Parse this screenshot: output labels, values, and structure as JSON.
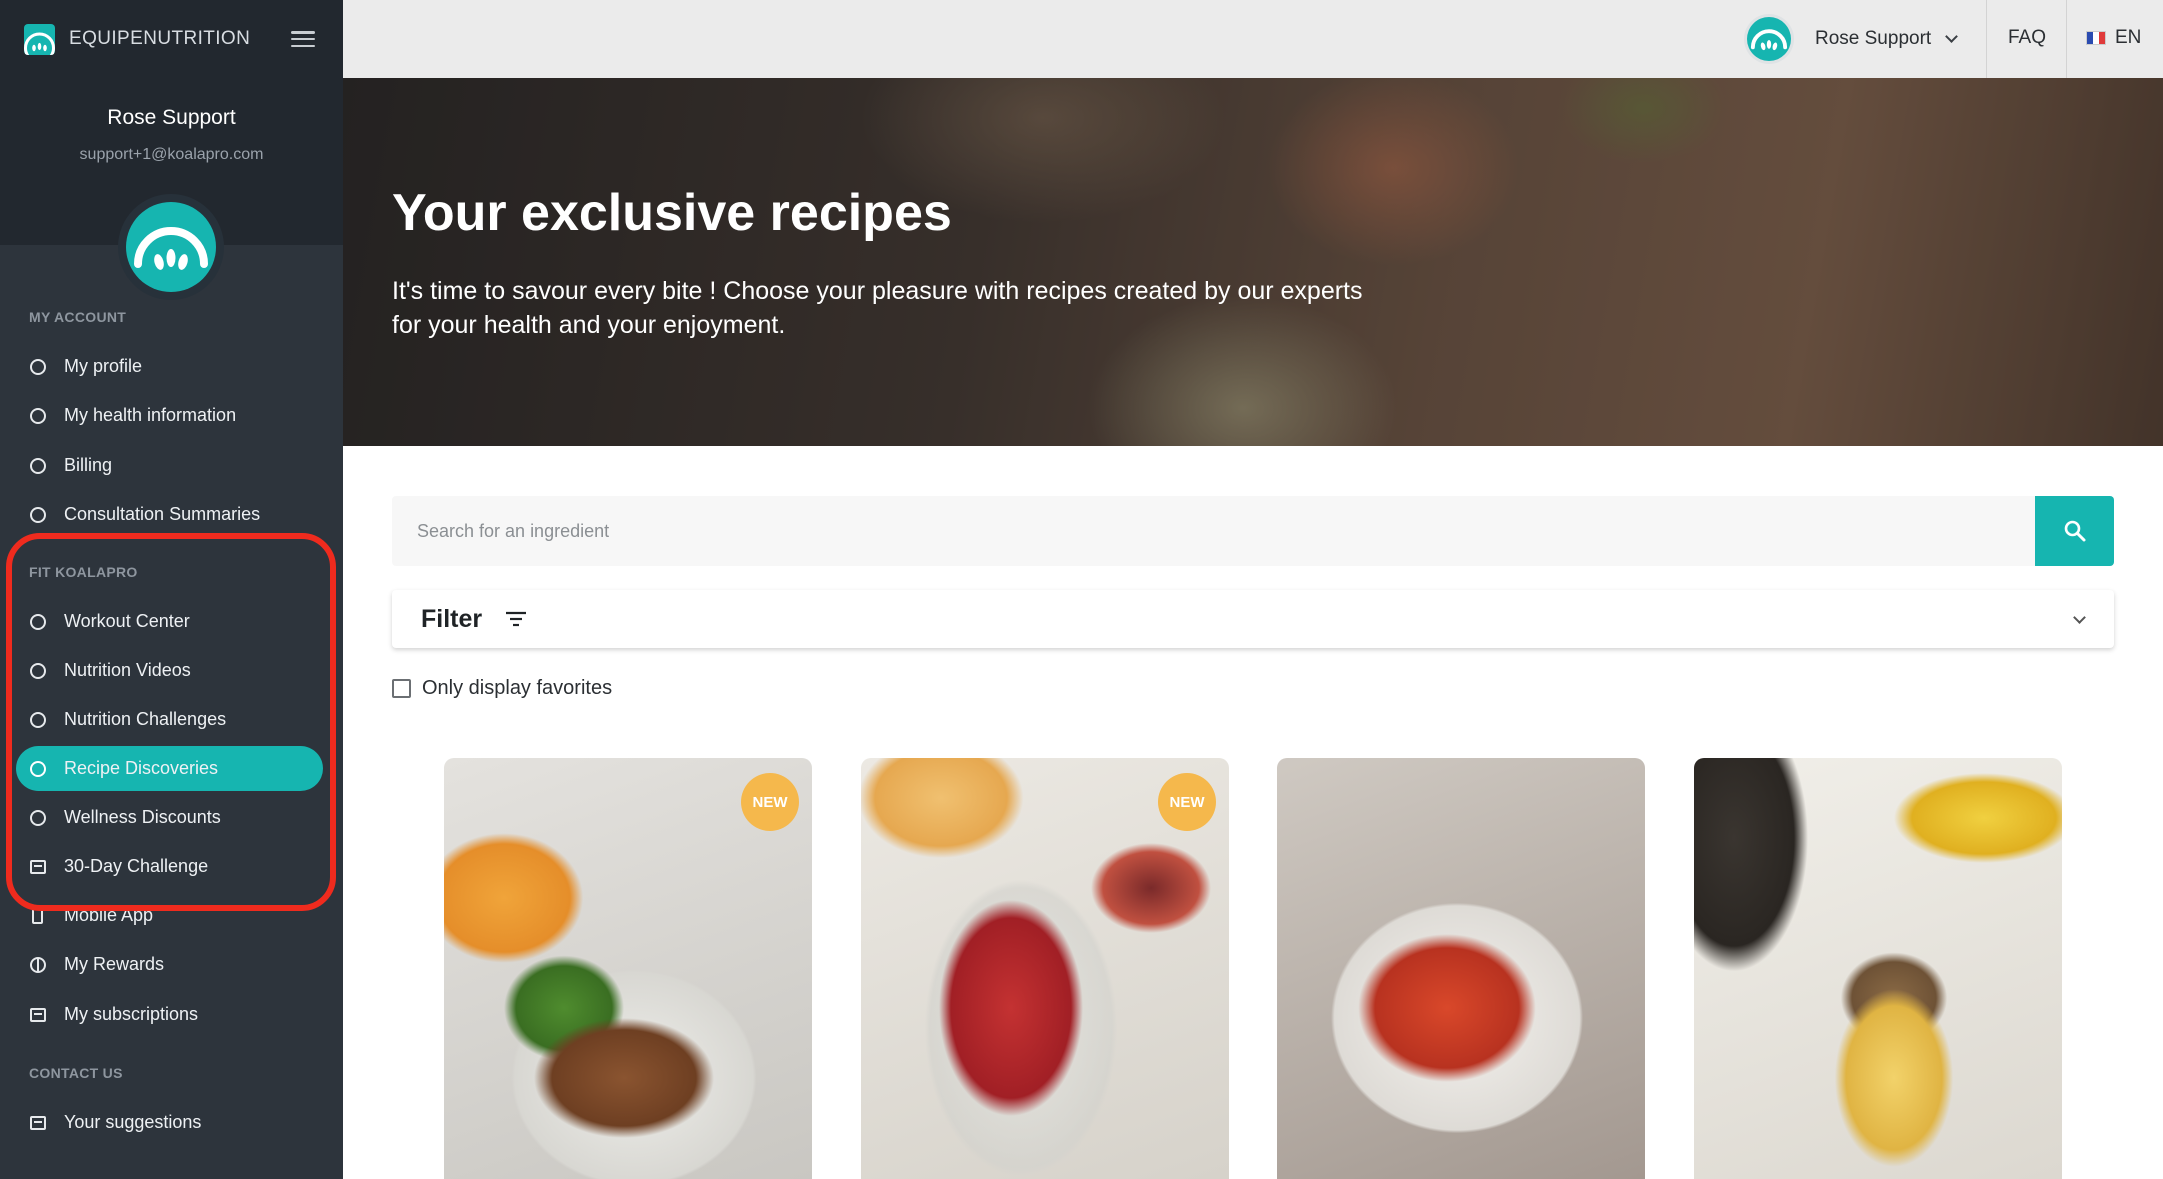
{
  "brand": {
    "name": "EQUIPENUTRITION"
  },
  "user": {
    "name": "Rose Support",
    "email": "support+1@koalapro.com"
  },
  "sidebar": {
    "sections": [
      {
        "title": "MY ACCOUNT"
      },
      {
        "title": "FIT KOALAPRO"
      },
      {
        "title": "CONTACT US"
      }
    ],
    "items": [
      {
        "label": "My profile",
        "icon": "circle-icon"
      },
      {
        "label": "My health information",
        "icon": "circle-icon"
      },
      {
        "label": "Billing",
        "icon": "circle-icon"
      },
      {
        "label": "Consultation Summaries",
        "icon": "circle-icon"
      },
      {
        "label": "Workout Center",
        "icon": "circle-icon"
      },
      {
        "label": "Nutrition Videos",
        "icon": "circle-icon"
      },
      {
        "label": "Nutrition Challenges",
        "icon": "circle-icon"
      },
      {
        "label": "Recipe Discoveries",
        "icon": "circle-icon",
        "active": true
      },
      {
        "label": "Wellness Discounts",
        "icon": "circle-icon"
      },
      {
        "label": "30-Day Challenge",
        "icon": "calendar-icon"
      },
      {
        "label": "Mobile App",
        "icon": "phone-icon"
      },
      {
        "label": "My Rewards",
        "icon": "gift-icon"
      },
      {
        "label": "My subscriptions",
        "icon": "subscription-icon"
      },
      {
        "label": "Your suggestions",
        "icon": "feedback-icon"
      }
    ]
  },
  "topbar": {
    "user_name": "Rose Support",
    "faq": "FAQ",
    "language": "EN"
  },
  "hero": {
    "title": "Your exclusive recipes",
    "subtitle": "It's time to savour every bite ! Choose your pleasure with recipes created by our experts for your health and your enjoyment."
  },
  "search": {
    "placeholder": "Search for an ingredient",
    "value": ""
  },
  "filter": {
    "label": "Filter"
  },
  "favorites": {
    "label": "Only display favorites",
    "checked": false
  },
  "recipes": [
    {
      "badge": "NEW"
    },
    {
      "badge": "NEW"
    },
    {
      "badge": ""
    },
    {
      "badge": ""
    }
  ],
  "colors": {
    "accent": "#16b5b0",
    "sidebar_bg": "#2d343c",
    "badge_new": "#f5b84c",
    "annotation_ring": "#ef2b1e"
  }
}
